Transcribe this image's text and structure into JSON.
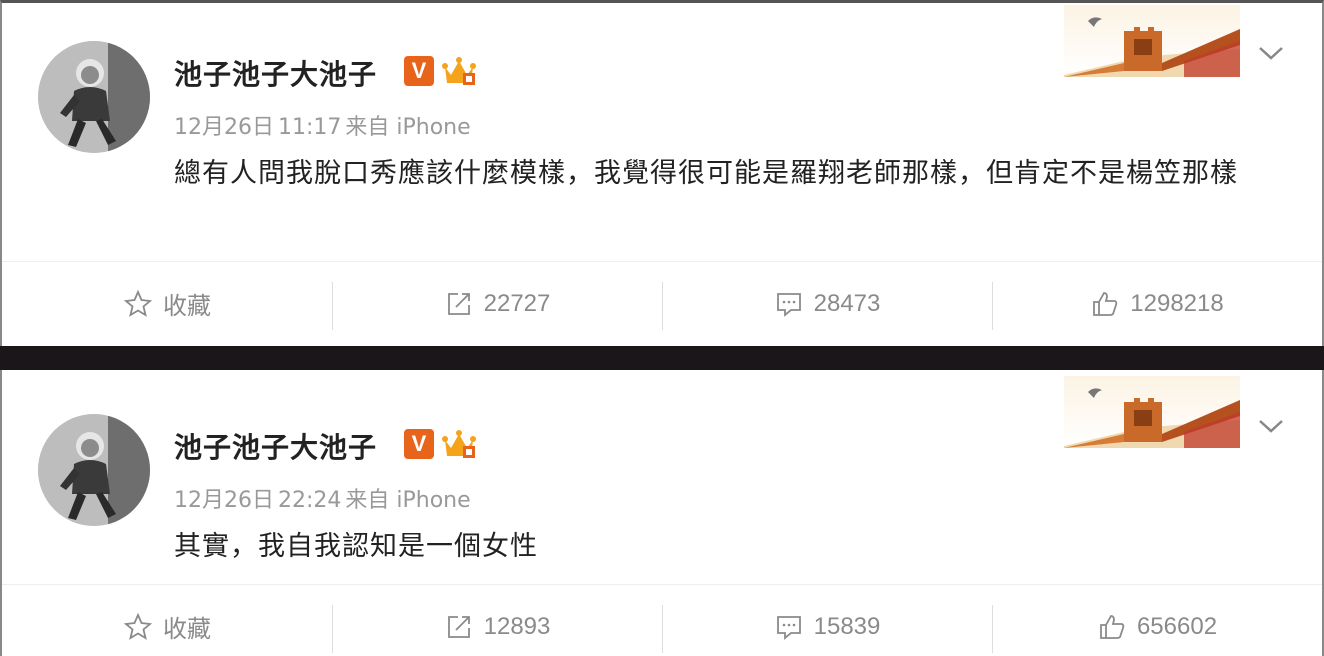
{
  "posts": [
    {
      "username": "池子池子大池子",
      "badge_v": "V",
      "meta": {
        "date": "12月26日",
        "time": "11:17",
        "source": "来自 iPhone"
      },
      "content": "總有人問我脫口秀應該什麼模樣，我覺得很可能是羅翔老師那樣，但肯定不是楊笠那樣",
      "actions": {
        "favorite": "收藏",
        "repost": "22727",
        "comment": "28473",
        "like": "1298218"
      }
    },
    {
      "username": "池子池子大池子",
      "badge_v": "V",
      "meta": {
        "date": "12月26日",
        "time": "22:24",
        "source": "来自 iPhone"
      },
      "content": "其實，我自我認知是一個女性",
      "actions": {
        "favorite": "收藏",
        "repost": "12893",
        "comment": "15839",
        "like": "656602"
      }
    }
  ],
  "colors": {
    "verified_badge": "#e8641b",
    "meta_text": "#999999",
    "action_text": "#8a8a8a",
    "divider": "#1b161a"
  },
  "icons": [
    "avatar-photo",
    "verified-v-icon",
    "crown-membership-icon",
    "great-wall-banner",
    "chevron-down-icon",
    "star-icon",
    "repost-icon",
    "comment-icon",
    "thumbs-up-icon"
  ]
}
